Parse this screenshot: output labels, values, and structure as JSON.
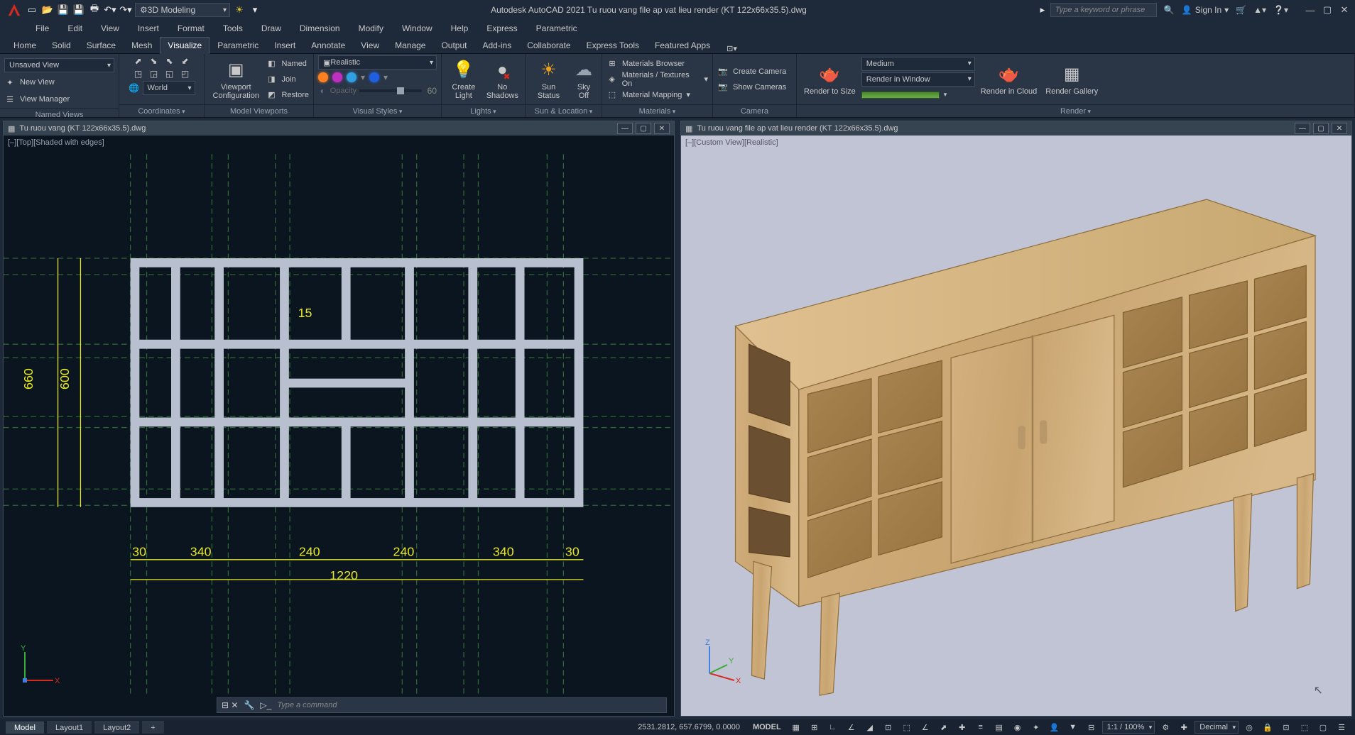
{
  "title": "Autodesk AutoCAD 2021   Tu ruou vang file ap vat lieu render (KT 122x66x35.5).dwg",
  "workspace_sel": "3D Modeling",
  "search_placeholder": "Type a keyword or phrase",
  "signin": "Sign In",
  "menus": [
    "File",
    "Edit",
    "View",
    "Insert",
    "Format",
    "Tools",
    "Draw",
    "Dimension",
    "Modify",
    "Window",
    "Help",
    "Express",
    "Parametric"
  ],
  "ribbon_tabs": [
    "Home",
    "Solid",
    "Surface",
    "Mesh",
    "Visualize",
    "Parametric",
    "Insert",
    "Annotate",
    "View",
    "Manage",
    "Output",
    "Add-ins",
    "Collaborate",
    "Express Tools",
    "Featured Apps"
  ],
  "active_tab": "Visualize",
  "panels": {
    "named_views": {
      "title": "Named Views",
      "sel": "Unsaved View",
      "items": [
        "New View",
        "View Manager"
      ]
    },
    "coordinates": {
      "title": "Coordinates",
      "ucs": "World"
    },
    "model_viewports": {
      "title": "Model Viewports",
      "btn": "Viewport Configuration",
      "named": "Named",
      "join": "Join",
      "restore": "Restore"
    },
    "visual_styles": {
      "title": "Visual Styles",
      "sel": "Realistic",
      "opacity": "Opacity",
      "opacity_val": "60"
    },
    "lights": {
      "title": "Lights",
      "btn": "Create Light",
      "shadows": "No Shadows"
    },
    "sun": {
      "title": "Sun & Location",
      "sun": "Sun Status",
      "sky": "Sky Off"
    },
    "materials": {
      "title": "Materials",
      "browser": "Materials Browser",
      "textures": "Materials / Textures On",
      "mapping": "Material Mapping"
    },
    "camera": {
      "title": "Camera",
      "create": "Create Camera",
      "show": "Show  Cameras"
    },
    "render": {
      "title": "Render",
      "size_btn": "Render to Size",
      "preset": "Medium",
      "target": "Render in Window",
      "cloud": "Render in Cloud",
      "gallery": "Render Gallery"
    }
  },
  "doc1": {
    "title": "Tu ruou vang (KT 122x66x35.5).dwg",
    "vp": "[–][Top][Shaded with edges]"
  },
  "doc2": {
    "title": "Tu ruou vang file ap vat lieu render (KT 122x66x35.5).dwg",
    "vp": "[–][Custom View][Realistic]"
  },
  "dims": {
    "d15": "15",
    "d660": "660",
    "d600": "600",
    "d30a": "30",
    "d340a": "340",
    "d240a": "240",
    "d240b": "240",
    "d340b": "340",
    "d30b": "30",
    "d1220": "1220"
  },
  "cmd_prompt": "Type  a  command",
  "status": {
    "tabs": [
      "Model",
      "Layout1",
      "Layout2"
    ],
    "active": "Model",
    "plus": "+",
    "coords": "2531.2812, 657.6799, 0.0000",
    "mode": "MODEL",
    "scale": "1:1 / 100%",
    "units": "Decimal"
  }
}
